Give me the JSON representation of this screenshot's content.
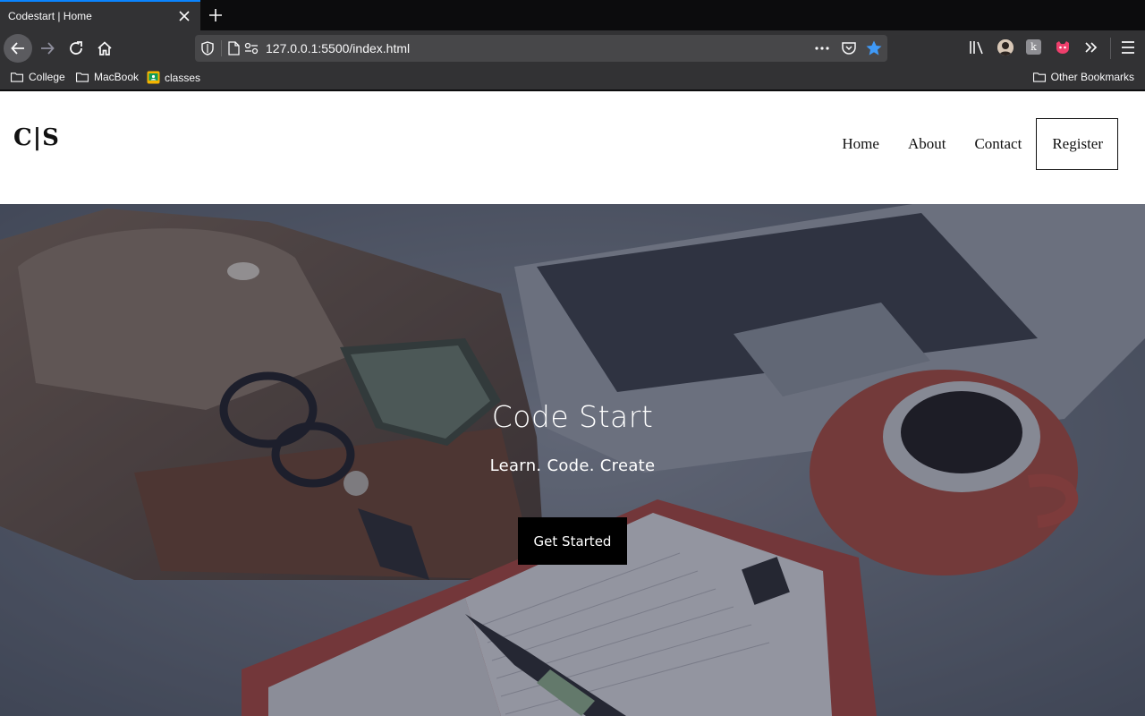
{
  "browser": {
    "tab_title": "Codestart | Home",
    "url": "127.0.0.1:5500/index.html",
    "icons": [
      "close-icon",
      "plus-icon",
      "back-icon",
      "forward-icon",
      "reload-icon",
      "home-icon",
      "shield-icon",
      "page-icon",
      "permissions-icon",
      "more-icon",
      "pocket-icon",
      "star-icon",
      "library-icon",
      "avatar-icon",
      "extension-icon",
      "pocket-extension-icon",
      "overflow-icon",
      "menu-icon"
    ],
    "bookmarks": [
      {
        "label": "College",
        "icon": "folder-icon"
      },
      {
        "label": "MacBook",
        "icon": "folder-icon"
      },
      {
        "label": "classes",
        "icon": "classroom-icon"
      }
    ],
    "other_bookmarks": "Other Bookmarks",
    "accent_color": "#0a84ff"
  },
  "site": {
    "logo": "C|S",
    "nav": [
      "Home",
      "About",
      "Contact"
    ],
    "register": "Register",
    "hero": {
      "title": "Code Start",
      "subtitle": "Learn. Code. Create",
      "cta": "Get Started"
    }
  }
}
